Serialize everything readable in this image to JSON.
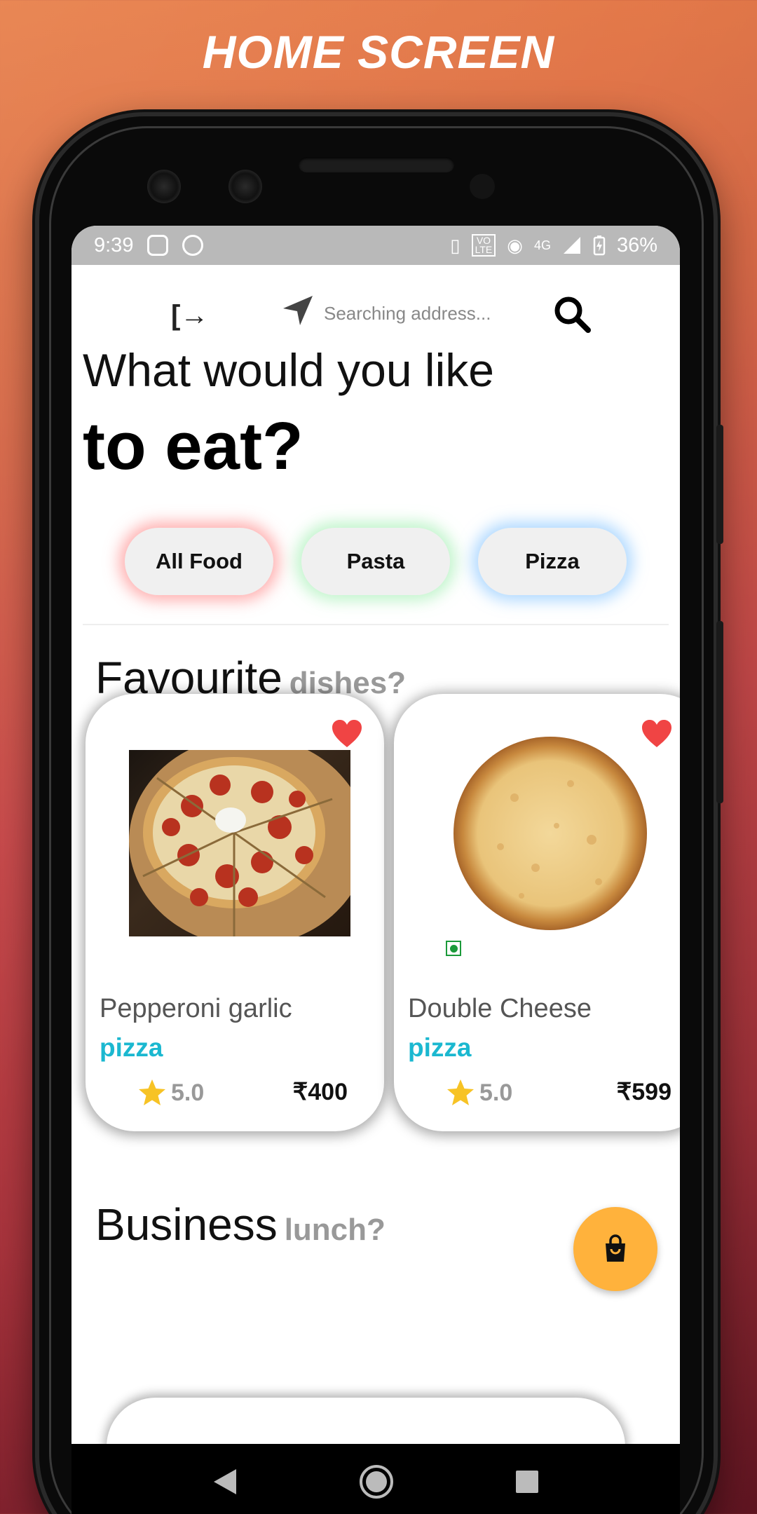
{
  "banner": {
    "title": "HOME SCREEN"
  },
  "status_bar": {
    "time": "9:39",
    "battery": "36%",
    "network": "4G"
  },
  "app_bar": {
    "address_placeholder": "Searching address..."
  },
  "headline": {
    "line1": "What would you like",
    "line2": "to eat?"
  },
  "categories": [
    {
      "label": "All Food",
      "glow": "#ff6e6e"
    },
    {
      "label": "Pasta",
      "glow": "#8cebA0"
    },
    {
      "label": "Pizza",
      "glow": "#78beff"
    }
  ],
  "favourite": {
    "title": "Favourite",
    "subtitle": "dishes?"
  },
  "dishes": [
    {
      "name": "Pepperoni garlic",
      "category": "pizza",
      "rating": "5.0",
      "currency": "₹",
      "price": "400"
    },
    {
      "name": "Double Cheese",
      "category": "pizza",
      "rating": "5.0",
      "currency": "₹",
      "price": "599"
    }
  ],
  "business": {
    "title": "Business",
    "subtitle": "lunch?"
  },
  "colors": {
    "accent_cyan": "#1bb8d0",
    "fab": "#ffb23c",
    "heart": "#f04444",
    "star": "#f7c325"
  },
  "icons": [
    "logout-icon",
    "navigation-arrow-icon",
    "search-icon",
    "heart-icon",
    "star-icon",
    "bag-icon",
    "back-icon",
    "home-icon",
    "recents-icon"
  ]
}
